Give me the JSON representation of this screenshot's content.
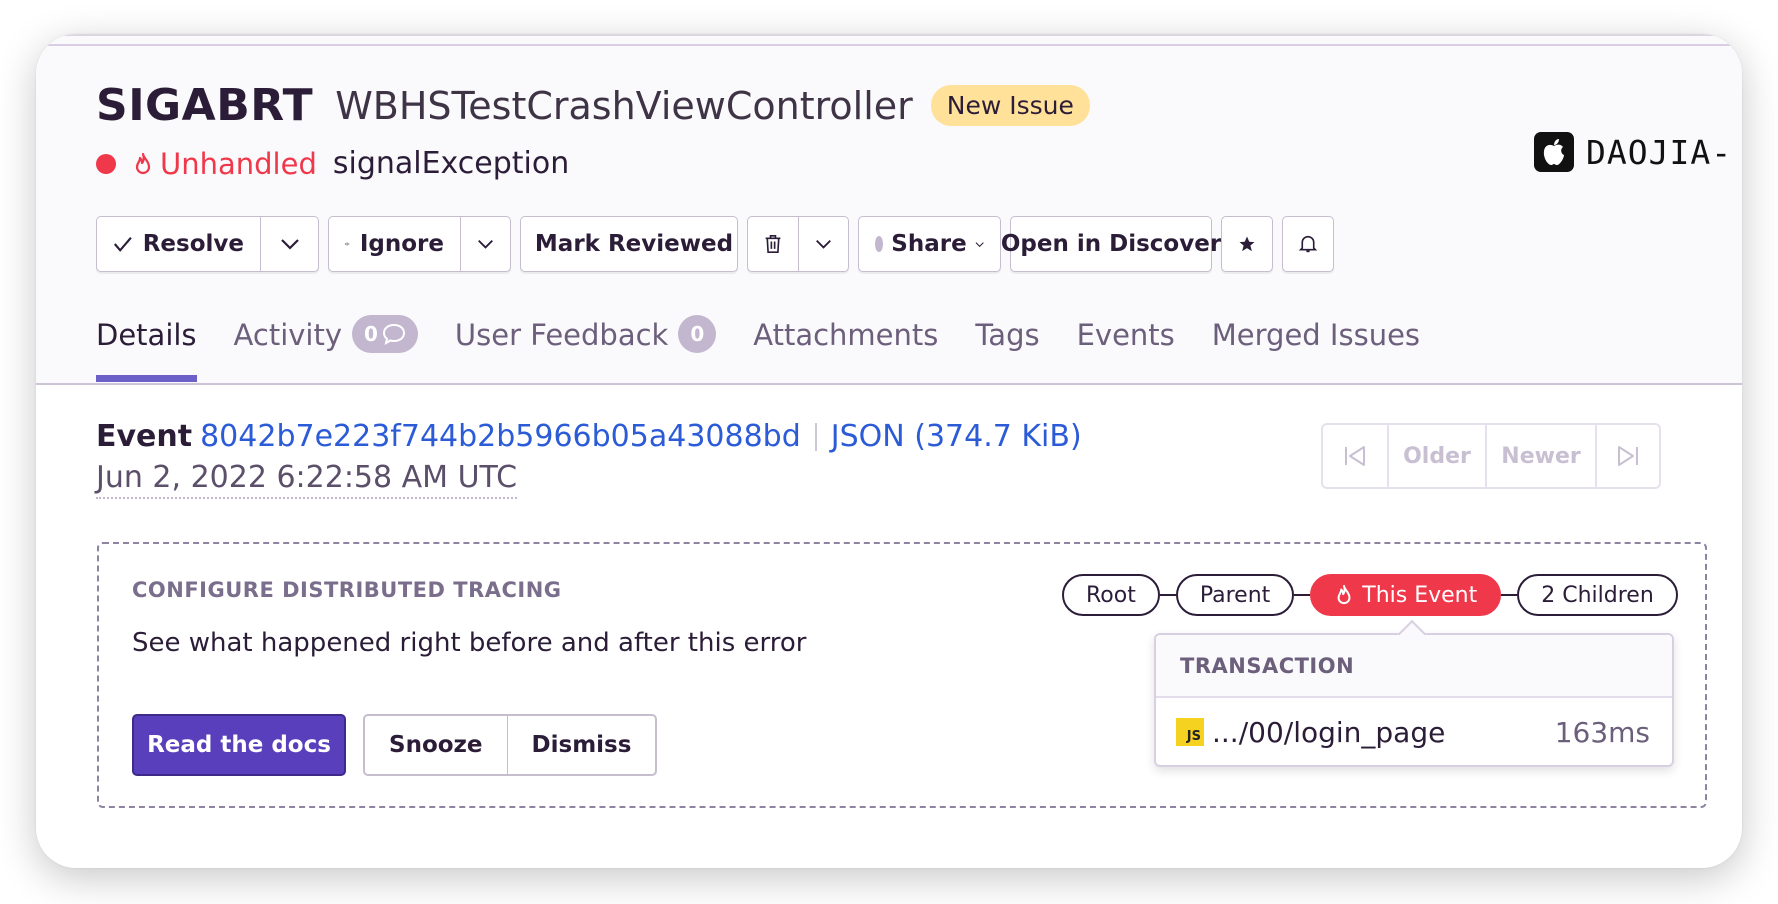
{
  "issue": {
    "title": "SIGABRT",
    "culprit": "WBHSTestCrashViewController",
    "badge": "New Issue",
    "unhandled_label": "Unhandled",
    "exception": "signalException",
    "platform_name": "DAOJIA-"
  },
  "toolbar": {
    "resolve": "Resolve",
    "ignore": "Ignore",
    "mark_reviewed": "Mark Reviewed",
    "share": "Share",
    "open_in_discover": "Open in Discover"
  },
  "tabs": [
    {
      "label": "Details",
      "active": true
    },
    {
      "label": "Activity",
      "count": "0"
    },
    {
      "label": "User Feedback",
      "count": "0"
    },
    {
      "label": "Attachments"
    },
    {
      "label": "Tags"
    },
    {
      "label": "Events"
    },
    {
      "label": "Merged Issues"
    }
  ],
  "event": {
    "label": "Event",
    "id": "8042b7e223f744b2b5966b05a43088bd",
    "json": "JSON (374.7 KiB)",
    "date": "Jun 2, 2022 6:22:58 AM UTC"
  },
  "pager": {
    "older": "Older",
    "newer": "Newer"
  },
  "tracing": {
    "title": "CONFIGURE DISTRIBUTED TRACING",
    "description": "See what happened right before and after this error",
    "read_docs": "Read the docs",
    "snooze": "Snooze",
    "dismiss": "Dismiss",
    "chain": {
      "root": "Root",
      "parent": "Parent",
      "this_event": "This Event",
      "children": "2 Children"
    },
    "tooltip": {
      "header": "TRANSACTION",
      "js_badge": "JS",
      "path": ".../00/login_page",
      "duration": "163ms"
    }
  },
  "colors": {
    "accent": "#6c5fc7",
    "error": "#f0384b",
    "link": "#2c5bd8",
    "badge_new": "#ffe19a",
    "primary_button": "#5a3fbc"
  }
}
